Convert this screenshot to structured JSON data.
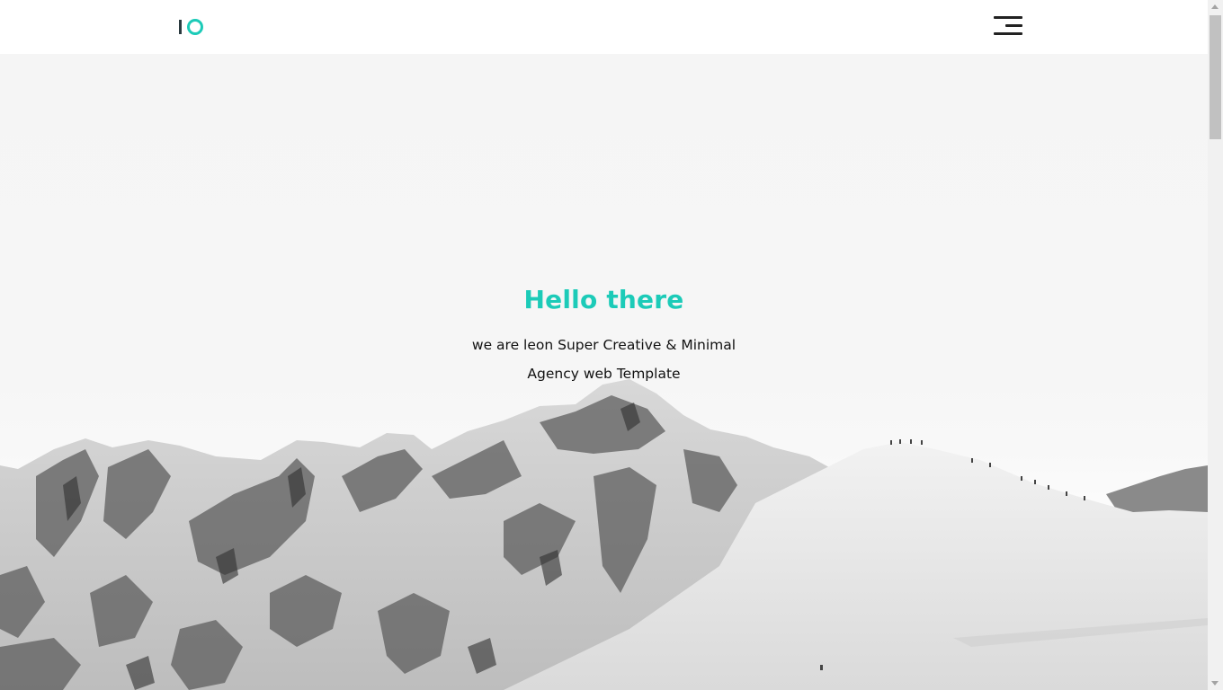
{
  "header": {
    "logo_icon": "io-logo-icon",
    "menu_icon": "hamburger-menu-icon"
  },
  "hero": {
    "title": "Hello there",
    "subtitle_line1": "we are leon Super Creative & Minimal",
    "subtitle_line2": "Agency web Template",
    "background": "snow-mountains-image"
  },
  "colors": {
    "accent": "#1ccbb8",
    "text": "#111111",
    "logo_dark": "#2b3a3f",
    "background": "#f5f5f5"
  }
}
